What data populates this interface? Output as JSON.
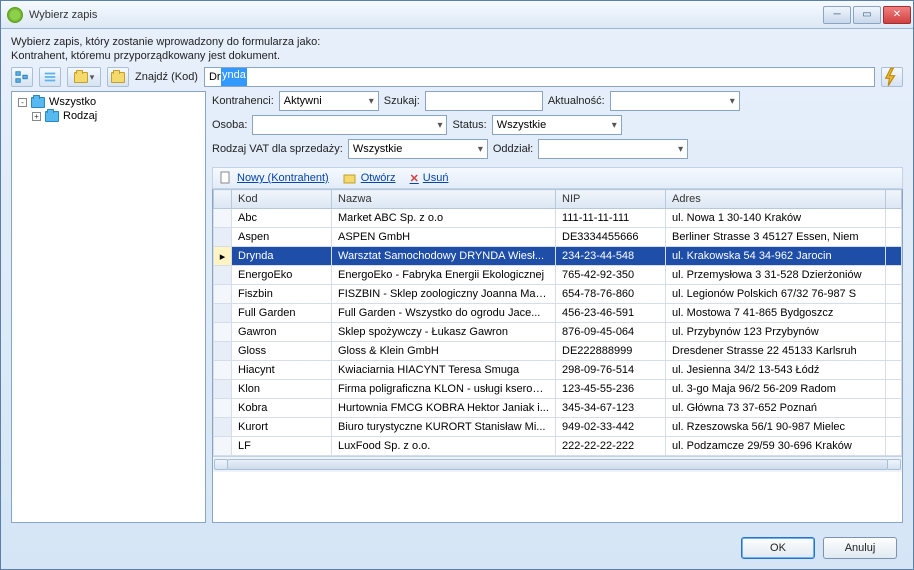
{
  "window": {
    "title": "Wybierz zapis"
  },
  "info": {
    "line1": "Wybierz zapis, który zostanie wprowadzony do formularza jako:",
    "line2": "Kontrahent, któremu przyporządkowany jest dokument."
  },
  "search": {
    "label": "Znajdź (Kod)",
    "typed": "Dr",
    "selected": "ynda"
  },
  "tree": {
    "root": "Wszystko",
    "child": "Rodzaj"
  },
  "filters": {
    "kontrahenci_label": "Kontrahenci:",
    "kontrahenci_value": "Aktywni",
    "szukaj_label": "Szukaj:",
    "szukaj_value": "",
    "aktualnosc_label": "Aktualność:",
    "aktualnosc_value": "",
    "osoba_label": "Osoba:",
    "osoba_value": "",
    "status_label": "Status:",
    "status_value": "Wszystkie",
    "vat_label": "Rodzaj VAT dla sprzedaży:",
    "vat_value": "Wszystkie",
    "oddzial_label": "Oddział:",
    "oddzial_value": ""
  },
  "actions": {
    "new": "Nowy (Kontrahent)",
    "open": "Otwórz",
    "delete": "Usuń"
  },
  "table": {
    "cols": {
      "kod": "Kod",
      "nazwa": "Nazwa",
      "nip": "NIP",
      "adres": "Adres"
    },
    "rows": [
      {
        "kod": "Abc",
        "nazwa": "Market ABC Sp. z o.o",
        "nip": "111-11-11-111",
        "adres": "ul. Nowa 1 30-140 Kraków"
      },
      {
        "kod": "Aspen",
        "nazwa": "ASPEN GmbH",
        "nip": "DE3334455666",
        "adres": "Berliner Strasse 3  45127 Essen, Niem"
      },
      {
        "kod": "Drynda",
        "nazwa": "Warsztat Samochodowy DRYNDA  Wiesł...",
        "nip": "234-23-44-548",
        "adres": "ul. Krakowska 54 34-962 Jarocin",
        "selected": true
      },
      {
        "kod": "EnergoEko",
        "nazwa": "EnergoEko - Fabryka Energii Ekologicznej",
        "nip": "765-42-92-350",
        "adres": "ul. Przemysłowa 3 31-528 Dzierżoniów"
      },
      {
        "kod": "Fiszbin",
        "nazwa": "FISZBIN - Sklep zoologiczny  Joanna Maz...",
        "nip": "654-78-76-860",
        "adres": "ul. Legionów Polskich 67/32 76-987 S"
      },
      {
        "kod": "Full Garden",
        "nazwa": "Full Garden - Wszystko do ogrodu  Jace...",
        "nip": "456-23-46-591",
        "adres": "ul. Mostowa 7 41-865 Bydgoszcz"
      },
      {
        "kod": "Gawron",
        "nazwa": "Sklep spożywczy - Łukasz Gawron",
        "nip": "876-09-45-064",
        "adres": "ul. Przybynów 123  Przybynów"
      },
      {
        "kod": "Gloss",
        "nazwa": "Gloss & Klein GmbH",
        "nip": "DE222888999",
        "adres": "Dresdener Strasse 22  45133 Karlsruh"
      },
      {
        "kod": "Hiacynt",
        "nazwa": "Kwiaciarnia HIACYNT  Teresa Smuga",
        "nip": "298-09-76-514",
        "adres": "ul. Jesienna 34/2 13-543 Łódź"
      },
      {
        "kod": "Klon",
        "nazwa": "Firma poligraficzna KLON - usługi kserogr...",
        "nip": "123-45-55-236",
        "adres": "ul. 3-go Maja 96/2 56-209 Radom"
      },
      {
        "kod": "Kobra",
        "nazwa": "Hurtownia FMCG KOBRA  Hektor Janiak i...",
        "nip": "345-34-67-123",
        "adres": "ul. Główna 73 37-652 Poznań"
      },
      {
        "kod": "Kurort",
        "nazwa": "Biuro turystyczne KURORT  Stanisław Mi...",
        "nip": "949-02-33-442",
        "adres": "ul. Rzeszowska 56/1 90-987 Mielec"
      },
      {
        "kod": "LF",
        "nazwa": "LuxFood Sp. z o.o.",
        "nip": "222-22-22-222",
        "adres": "ul. Podzamcze 29/59 30-696 Kraków"
      }
    ]
  },
  "buttons": {
    "ok": "OK",
    "cancel": "Anuluj"
  }
}
